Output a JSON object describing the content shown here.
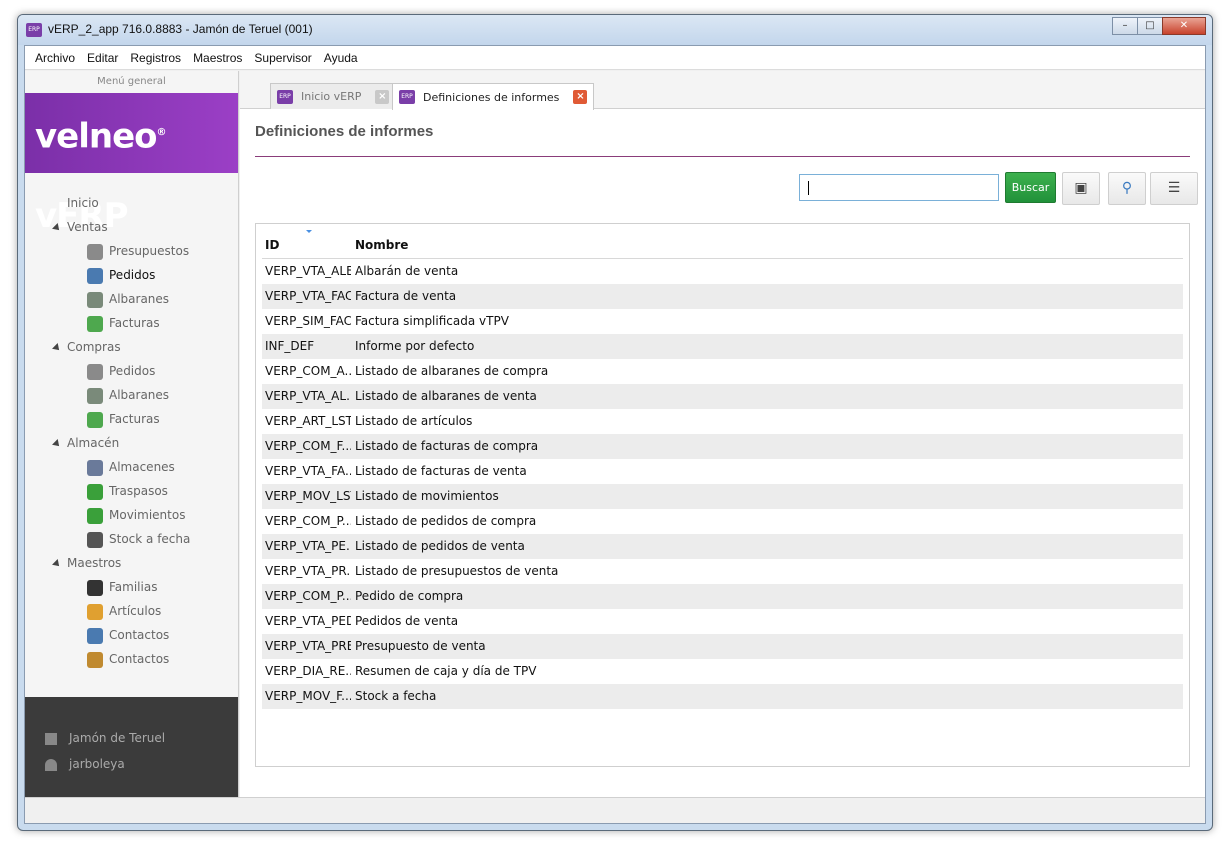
{
  "window": {
    "title": "vERP_2_app 716.0.8883 - Jamón de Teruel (001)",
    "icon": "ERP"
  },
  "menubar": [
    "Archivo",
    "Editar",
    "Registros",
    "Maestros",
    "Supervisor",
    "Ayuda"
  ],
  "sidebar": {
    "header": "Menú general",
    "logo_main": "velneo",
    "logo_mark": "®",
    "logo_product": "vERP",
    "nav": [
      {
        "type": "top",
        "label": "Inicio"
      },
      {
        "type": "group",
        "label": "Ventas"
      },
      {
        "type": "child",
        "label": "Presupuestos",
        "icon": "quote-icon",
        "color": "#8a8a8a"
      },
      {
        "type": "child",
        "label": "Pedidos",
        "icon": "order-icon",
        "color": "#4a7ab0",
        "active": true
      },
      {
        "type": "child",
        "label": "Albaranes",
        "icon": "delivery-note-icon",
        "color": "#7a8a7a"
      },
      {
        "type": "child",
        "label": "Facturas",
        "icon": "invoice-icon",
        "color": "#4ea84e"
      },
      {
        "type": "group",
        "label": "Compras"
      },
      {
        "type": "child",
        "label": "Pedidos",
        "icon": "order-icon",
        "color": "#8a8a8a"
      },
      {
        "type": "child",
        "label": "Albaranes",
        "icon": "delivery-note-icon",
        "color": "#7a8a7a"
      },
      {
        "type": "child",
        "label": "Facturas",
        "icon": "invoice-icon",
        "color": "#4ea84e"
      },
      {
        "type": "group",
        "label": "Almacén"
      },
      {
        "type": "child",
        "label": "Almacenes",
        "icon": "warehouse-icon",
        "color": "#6a7a9a"
      },
      {
        "type": "child",
        "label": "Traspasos",
        "icon": "transfer-icon",
        "color": "#3aa03a"
      },
      {
        "type": "child",
        "label": "Movimientos",
        "icon": "movements-icon",
        "color": "#3aa03a"
      },
      {
        "type": "child",
        "label": "Stock a fecha",
        "icon": "stock-date-icon",
        "color": "#555555"
      },
      {
        "type": "group",
        "label": "Maestros"
      },
      {
        "type": "child",
        "label": "Familias",
        "icon": "families-icon",
        "color": "#333333"
      },
      {
        "type": "child",
        "label": "Artículos",
        "icon": "article-icon",
        "color": "#e0a030"
      },
      {
        "type": "child",
        "label": "Contactos",
        "icon": "contact-icon",
        "color": "#4a7ab0"
      },
      {
        "type": "child",
        "label": "Contactos",
        "icon": "contact-card-icon",
        "color": "#c08a30"
      }
    ],
    "footer": {
      "company": "Jamón de Teruel",
      "user": "jarboleya"
    }
  },
  "tabs": [
    {
      "label": "Inicio vERP",
      "active": false
    },
    {
      "label": "Definiciones de informes",
      "active": true
    }
  ],
  "page": {
    "title": "Definiciones de informes"
  },
  "search": {
    "value": "",
    "button_label": "Buscar"
  },
  "colors": {
    "brand": "#8e38b8",
    "accent_rule": "#8a3c7a",
    "search_button": "#2ea043",
    "close_tab": "#e05a35"
  },
  "table": {
    "columns": [
      "ID",
      "Nombre"
    ],
    "rows": [
      [
        "VERP_VTA_ALB",
        "Albarán de venta"
      ],
      [
        "VERP_VTA_FAC",
        "Factura de venta"
      ],
      [
        "VERP_SIM_FAC",
        "Factura simplificada vTPV"
      ],
      [
        "INF_DEF",
        "Informe por defecto"
      ],
      [
        "VERP_COM_A...",
        "Listado de albaranes de compra"
      ],
      [
        "VERP_VTA_AL...",
        "Listado de albaranes de venta"
      ],
      [
        "VERP_ART_LST",
        "Listado de artículos"
      ],
      [
        "VERP_COM_F...",
        "Listado de facturas de compra"
      ],
      [
        "VERP_VTA_FA...",
        "Listado de facturas de venta"
      ],
      [
        "VERP_MOV_LST",
        "Listado de movimientos"
      ],
      [
        "VERP_COM_P...",
        "Listado de pedidos de compra"
      ],
      [
        "VERP_VTA_PE...",
        "Listado de pedidos de venta"
      ],
      [
        "VERP_VTA_PR...",
        "Listado de presupuestos de venta"
      ],
      [
        "VERP_COM_P...",
        "Pedido de compra"
      ],
      [
        "VERP_VTA_PED",
        "Pedidos de venta"
      ],
      [
        "VERP_VTA_PRE",
        "Presupuesto de venta"
      ],
      [
        "VERP_DIA_RE...",
        "Resumen de caja y día de TPV"
      ],
      [
        "VERP_MOV_F...",
        "Stock a fecha"
      ]
    ]
  }
}
